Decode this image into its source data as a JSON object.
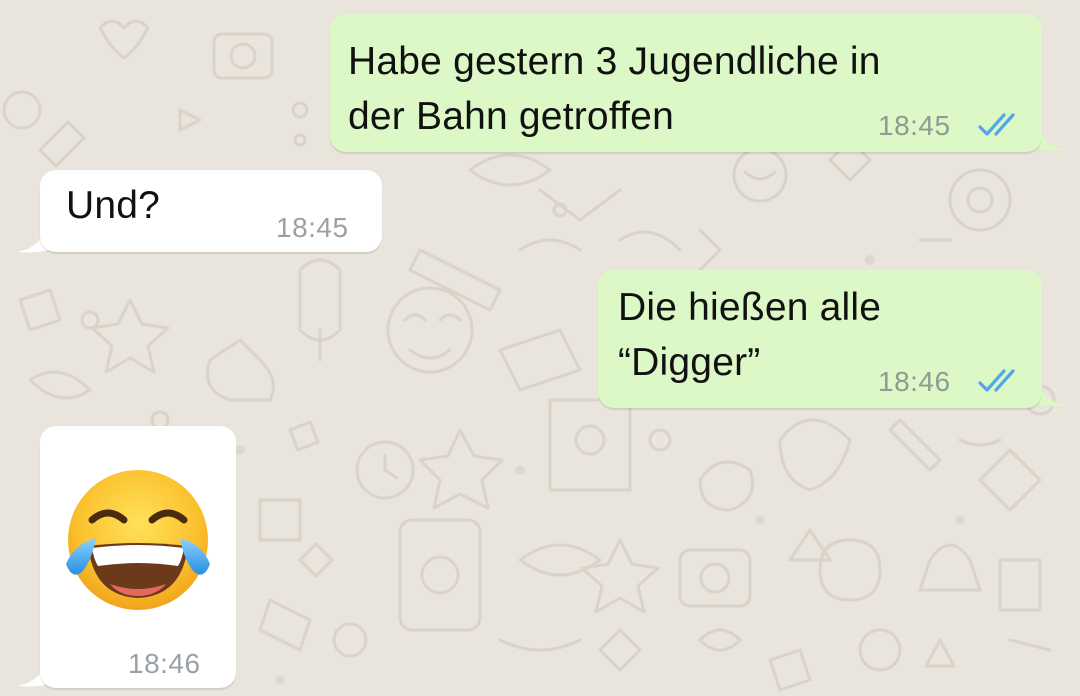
{
  "chat": {
    "messages": [
      {
        "id": "m1",
        "direction": "outgoing",
        "text": "Habe gestern 3 Jugendliche in\nder Bahn getroffen",
        "time": "18:45",
        "status": "read",
        "status_icon": "double-check-icon"
      },
      {
        "id": "m2",
        "direction": "incoming",
        "text": "Und?",
        "time": "18:45"
      },
      {
        "id": "m3",
        "direction": "outgoing",
        "text": "Die hießen alle\n“Digger”",
        "time": "18:46",
        "status": "read",
        "status_icon": "double-check-icon"
      },
      {
        "id": "m4",
        "direction": "incoming",
        "emoji": "face-with-tears-of-joy-icon",
        "time": "18:46"
      }
    ]
  },
  "colors": {
    "background": "#e9e4dc",
    "outgoing_bubble": "#dcf8c6",
    "incoming_bubble": "#ffffff",
    "read_ticks": "#4fa6e8",
    "timestamp": "#8e9a92"
  }
}
